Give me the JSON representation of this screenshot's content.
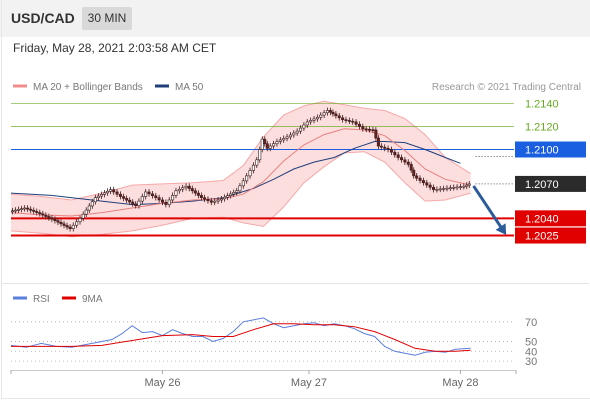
{
  "header": {
    "pair": "USD/CAD",
    "timeframe": "30 MIN"
  },
  "timestamp": "Friday, May 28, 2021 2:03:58 AM CET",
  "chart_data": {
    "type": "line",
    "main": {
      "legend": [
        {
          "name": "MA 20 + Bollinger Bands",
          "color": "#f28c8c"
        },
        {
          "name": "MA 50",
          "color": "#1f3f7a"
        }
      ],
      "copyright": "Research © 2021 Trading Central",
      "ylim": [
        1.19845,
        1.21475
      ],
      "levels": [
        {
          "label": "1.2140",
          "value": 1.214,
          "color": "#66aa22",
          "style": "green",
          "text_color": "#66aa22"
        },
        {
          "label": "1.2120",
          "value": 1.212,
          "color": "#66aa22",
          "style": "green",
          "text_color": "#66aa22"
        },
        {
          "label": "1.2100",
          "value": 1.21,
          "color": "#1a5fe0",
          "style": "blue",
          "text_color": "#ffffff"
        },
        {
          "label": "1.2070",
          "value": 1.207,
          "color": "#2b2b2b",
          "style": "current",
          "text_color": "#ffffff"
        },
        {
          "label": "1.2040",
          "value": 1.204,
          "color": "#e00000",
          "style": "red",
          "text_color": "#ffffff"
        },
        {
          "label": "1.2025",
          "value": 1.2025,
          "color": "#e00000",
          "style": "red",
          "text_color": "#ffffff"
        }
      ],
      "price_path": [
        [
          0,
          1.2046
        ],
        [
          3,
          1.2049
        ],
        [
          6,
          1.2044
        ],
        [
          9,
          1.2038
        ],
        [
          12,
          1.2031
        ],
        [
          14,
          1.204
        ],
        [
          17,
          1.2058
        ],
        [
          20,
          1.2065
        ],
        [
          22,
          1.2059
        ],
        [
          25,
          1.2051
        ],
        [
          27,
          1.2063
        ],
        [
          29,
          1.2058
        ],
        [
          31,
          1.2052
        ],
        [
          33,
          1.2064
        ],
        [
          35,
          1.2068
        ],
        [
          38,
          1.2058
        ],
        [
          40,
          1.2054
        ],
        [
          42,
          1.2057
        ],
        [
          45,
          1.2064
        ],
        [
          47,
          1.2077
        ],
        [
          49,
          1.2091
        ],
        [
          50,
          1.2109
        ],
        [
          51,
          1.2101
        ],
        [
          53,
          1.2107
        ],
        [
          55,
          1.2111
        ],
        [
          57,
          1.2116
        ],
        [
          59,
          1.2124
        ],
        [
          61,
          1.2128
        ],
        [
          63,
          1.2134
        ],
        [
          64,
          1.2131
        ],
        [
          66,
          1.2126
        ],
        [
          68,
          1.2124
        ],
        [
          70,
          1.2118
        ],
        [
          72,
          1.2117
        ],
        [
          73,
          1.2103
        ],
        [
          75,
          1.21
        ],
        [
          77,
          1.2093
        ],
        [
          79,
          1.2087
        ],
        [
          80,
          1.2077
        ],
        [
          82,
          1.2071
        ],
        [
          84,
          1.2065
        ],
        [
          86,
          1.2066
        ],
        [
          88,
          1.2067
        ],
        [
          90,
          1.2068
        ],
        [
          91,
          1.207
        ]
      ],
      "ma20": [
        [
          0,
          1.2045
        ],
        [
          6,
          1.2043
        ],
        [
          12,
          1.2042
        ],
        [
          18,
          1.2045
        ],
        [
          24,
          1.2049
        ],
        [
          30,
          1.2053
        ],
        [
          36,
          1.2056
        ],
        [
          42,
          1.2057
        ],
        [
          46,
          1.2061
        ],
        [
          50,
          1.2072
        ],
        [
          54,
          1.209
        ],
        [
          58,
          1.2104
        ],
        [
          62,
          1.2113
        ],
        [
          66,
          1.2118
        ],
        [
          70,
          1.2117
        ],
        [
          74,
          1.2112
        ],
        [
          78,
          1.2099
        ],
        [
          82,
          1.2083
        ],
        [
          86,
          1.2074
        ],
        [
          91,
          1.2069
        ]
      ],
      "bb_upper": [
        [
          0,
          1.2061
        ],
        [
          6,
          1.2059
        ],
        [
          12,
          1.2056
        ],
        [
          18,
          1.2062
        ],
        [
          24,
          1.2069
        ],
        [
          30,
          1.207
        ],
        [
          36,
          1.2071
        ],
        [
          42,
          1.2073
        ],
        [
          46,
          1.2086
        ],
        [
          50,
          1.2111
        ],
        [
          54,
          1.213
        ],
        [
          58,
          1.2138
        ],
        [
          62,
          1.2142
        ],
        [
          66,
          1.2139
        ],
        [
          70,
          1.2136
        ],
        [
          74,
          1.2134
        ],
        [
          78,
          1.2127
        ],
        [
          82,
          1.2113
        ],
        [
          86,
          1.2093
        ],
        [
          91,
          1.2079
        ]
      ],
      "bb_lower": [
        [
          0,
          1.2029
        ],
        [
          6,
          1.2027
        ],
        [
          12,
          1.2024
        ],
        [
          18,
          1.2026
        ],
        [
          24,
          1.2029
        ],
        [
          30,
          1.2034
        ],
        [
          36,
          1.204
        ],
        [
          42,
          1.2041
        ],
        [
          46,
          1.2036
        ],
        [
          50,
          1.2033
        ],
        [
          54,
          1.205
        ],
        [
          58,
          1.2071
        ],
        [
          62,
          1.2085
        ],
        [
          66,
          1.2097
        ],
        [
          70,
          1.2098
        ],
        [
          74,
          1.2089
        ],
        [
          78,
          1.2071
        ],
        [
          82,
          1.2055
        ],
        [
          86,
          1.2056
        ],
        [
          91,
          1.2062
        ]
      ],
      "ma50": [
        [
          0,
          1.2062
        ],
        [
          8,
          1.206
        ],
        [
          16,
          1.2056
        ],
        [
          24,
          1.2052
        ],
        [
          30,
          1.2053
        ],
        [
          36,
          1.2055
        ],
        [
          42,
          1.2058
        ],
        [
          48,
          1.2066
        ],
        [
          52,
          1.2074
        ],
        [
          56,
          1.2083
        ],
        [
          60,
          1.2089
        ],
        [
          64,
          1.2093
        ],
        [
          68,
          1.2101
        ],
        [
          72,
          1.2107
        ],
        [
          74,
          1.2107
        ],
        [
          78,
          1.2106
        ],
        [
          82,
          1.21
        ],
        [
          86,
          1.2093
        ],
        [
          89,
          1.2088
        ]
      ],
      "projection": {
        "from": [
          91,
          1.207
        ],
        "to": [
          98,
          1.2025
        ]
      }
    },
    "rsi": {
      "legend": [
        {
          "name": "RSI",
          "color": "#5b7fdd"
        },
        {
          "name": "9MA",
          "color": "#e00000"
        }
      ],
      "ylim": [
        25,
        80
      ],
      "ticks": [
        {
          "label": "70",
          "value": 70
        },
        {
          "label": "50",
          "value": 50
        },
        {
          "label": "40",
          "value": 40
        },
        {
          "label": "30",
          "value": 30
        }
      ],
      "rsi": [
        [
          0,
          46
        ],
        [
          3,
          44
        ],
        [
          6,
          48
        ],
        [
          9,
          45
        ],
        [
          12,
          44
        ],
        [
          15,
          47
        ],
        [
          18,
          50
        ],
        [
          20,
          52
        ],
        [
          22,
          58
        ],
        [
          24,
          66
        ],
        [
          26,
          59
        ],
        [
          28,
          60
        ],
        [
          30,
          56
        ],
        [
          32,
          62
        ],
        [
          34,
          58
        ],
        [
          36,
          55
        ],
        [
          38,
          55
        ],
        [
          40,
          50
        ],
        [
          42,
          53
        ],
        [
          44,
          60
        ],
        [
          46,
          70
        ],
        [
          48,
          72
        ],
        [
          50,
          74
        ],
        [
          52,
          68
        ],
        [
          54,
          64
        ],
        [
          56,
          66
        ],
        [
          58,
          68
        ],
        [
          60,
          69
        ],
        [
          62,
          66
        ],
        [
          64,
          68
        ],
        [
          66,
          66
        ],
        [
          68,
          63
        ],
        [
          70,
          58
        ],
        [
          72,
          55
        ],
        [
          74,
          45
        ],
        [
          76,
          40
        ],
        [
          78,
          38
        ],
        [
          80,
          36
        ],
        [
          82,
          39
        ],
        [
          84,
          40
        ],
        [
          86,
          39
        ],
        [
          88,
          42
        ],
        [
          91,
          43
        ]
      ],
      "ma9": [
        [
          0,
          45
        ],
        [
          6,
          45
        ],
        [
          12,
          45
        ],
        [
          18,
          46
        ],
        [
          24,
          51
        ],
        [
          30,
          56
        ],
        [
          36,
          57
        ],
        [
          40,
          55
        ],
        [
          44,
          55
        ],
        [
          48,
          62
        ],
        [
          52,
          68
        ],
        [
          56,
          68
        ],
        [
          60,
          67
        ],
        [
          64,
          67
        ],
        [
          68,
          65
        ],
        [
          72,
          60
        ],
        [
          76,
          52
        ],
        [
          80,
          43
        ],
        [
          84,
          40
        ],
        [
          88,
          40
        ],
        [
          91,
          41
        ]
      ]
    },
    "x_axis": {
      "xlim": [
        0,
        100
      ],
      "ticks": [
        {
          "label": "May 26",
          "value": 30
        },
        {
          "label": "May 27",
          "value": 59
        },
        {
          "label": "May 28",
          "value": 89
        }
      ]
    }
  }
}
